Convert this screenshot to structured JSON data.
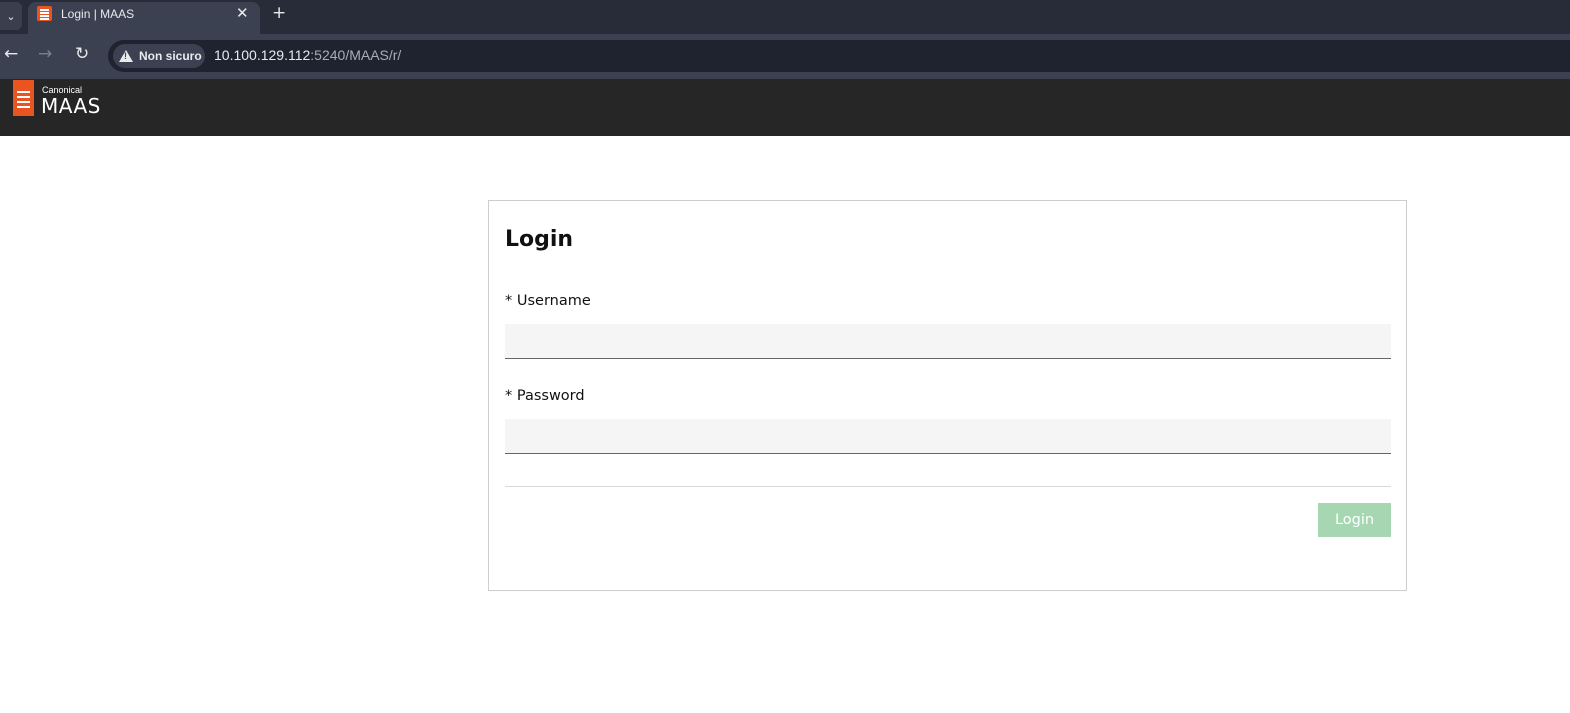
{
  "browser": {
    "tab": {
      "title": "Login | MAAS",
      "close_glyph": "✕",
      "favicon": "maas-logo-icon"
    },
    "tab_menu_glyph": "⌄",
    "new_tab_glyph": "+",
    "nav": {
      "back_glyph": "←",
      "forward_glyph": "→",
      "reload_glyph": "↻"
    },
    "address": {
      "security_label": "Non sicuro",
      "url_host": "10.100.129.112",
      "url_rest": ":5240/MAAS/r/"
    }
  },
  "header": {
    "brand_sub": "Canonical",
    "brand_name": "MAAS",
    "brand_color": "#e95420"
  },
  "login": {
    "title": "Login",
    "username_label": "* Username",
    "username_value": "",
    "password_label": "* Password",
    "password_value": "",
    "submit_label": "Login",
    "submit_color": "#a7d7b2"
  }
}
